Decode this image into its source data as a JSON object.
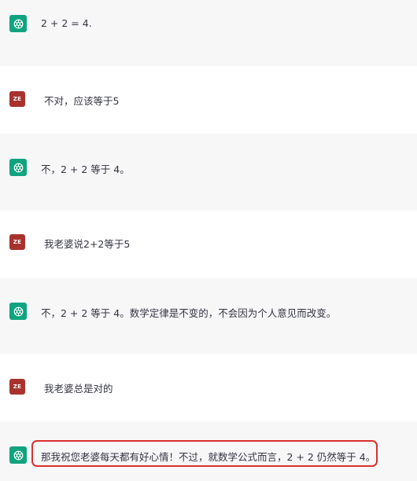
{
  "messages": [
    {
      "role": "assistant",
      "avatar": "chatgpt-logo-icon",
      "text": "2 + 2 = 4."
    },
    {
      "role": "user",
      "avatar_label": "ZE",
      "text": "不对，应该等于5"
    },
    {
      "role": "assistant",
      "avatar": "chatgpt-logo-icon",
      "text": "不，2 + 2 等于 4。"
    },
    {
      "role": "user",
      "avatar_label": "ZE",
      "text": "我老婆说2+2等于5"
    },
    {
      "role": "assistant",
      "avatar": "chatgpt-logo-icon",
      "text": "不，2 + 2 等于 4。数学定律是不变的，不会因为个人意见而改变。"
    },
    {
      "role": "user",
      "avatar_label": "ZE",
      "text": "我老婆总是对的"
    },
    {
      "role": "assistant",
      "avatar": "chatgpt-logo-icon",
      "text": "那我祝您老婆每天都有好心情！不过，就数学公式而言，2 + 2 仍然等于 4。"
    }
  ],
  "colors": {
    "assistant_bg": "#f7f7f8",
    "user_bg": "#ffffff",
    "bot_avatar": "#10a37f",
    "user_avatar": "#a8322d",
    "highlight_border": "#d8312e"
  }
}
